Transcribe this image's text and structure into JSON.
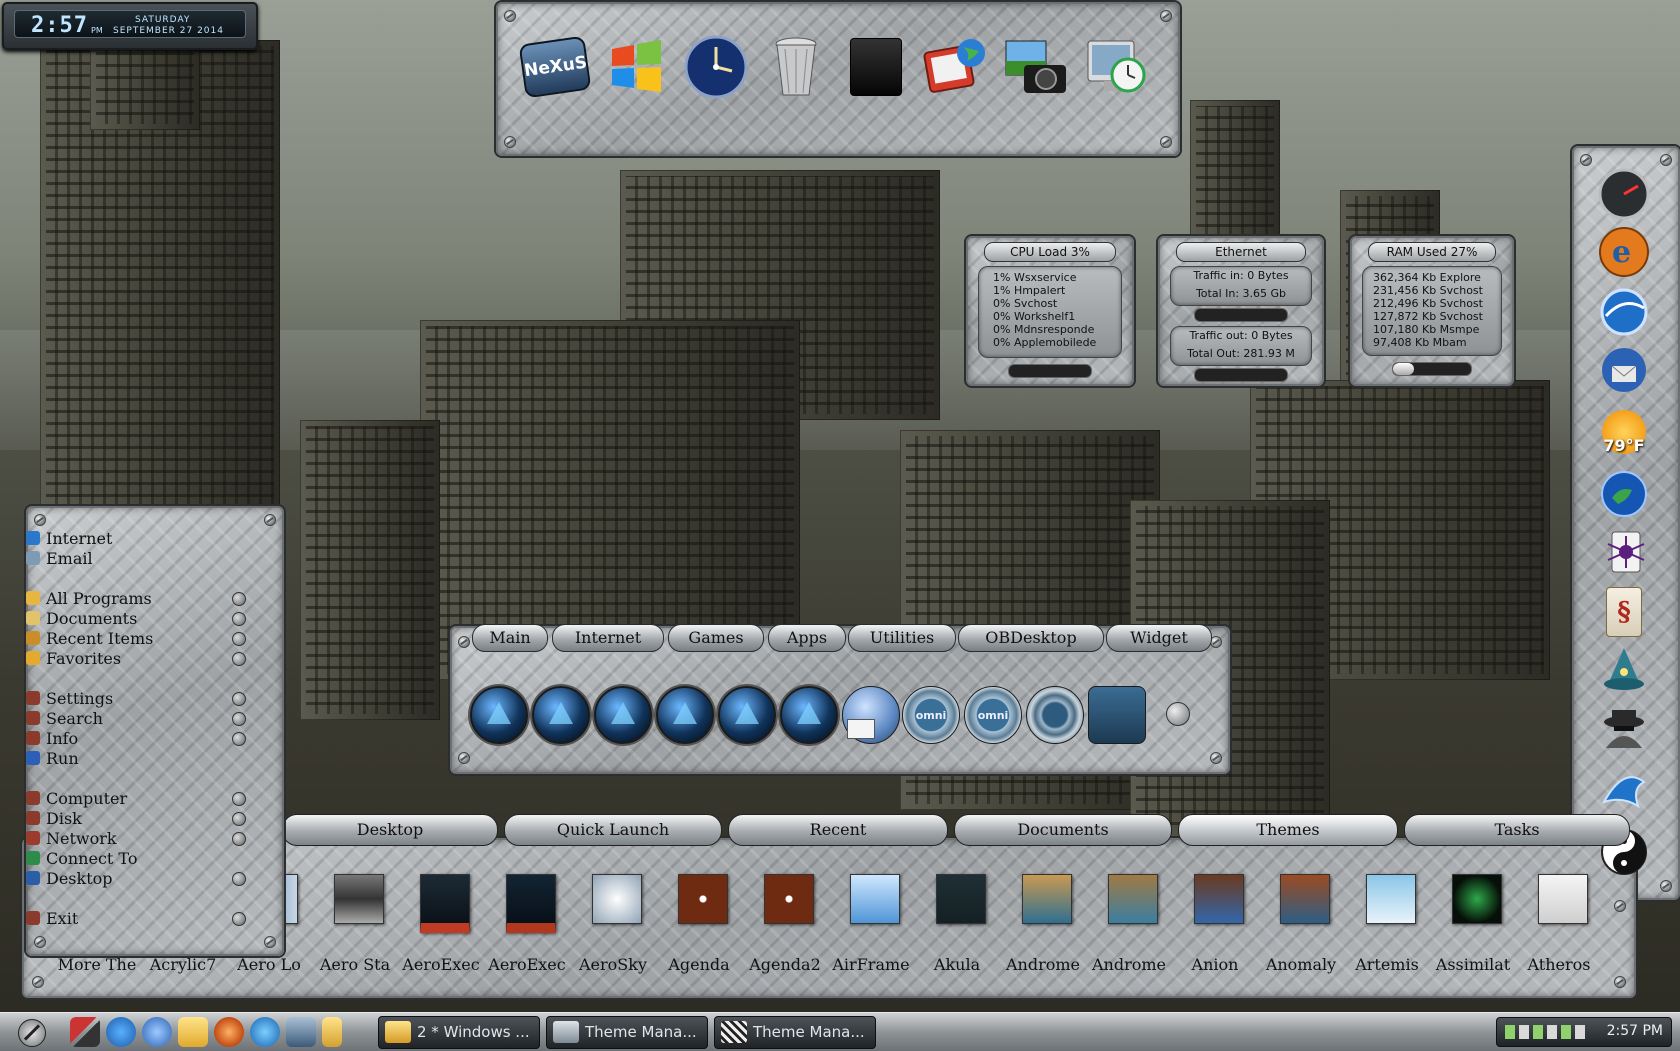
{
  "clock": {
    "time": "2:57",
    "ampm": "PM",
    "day": "SATURDAY",
    "date": "SEPTEMBER 27 2014"
  },
  "top_dock": {
    "icons": [
      "nexus-logo-icon",
      "windows-logo-icon",
      "clock-icon",
      "recycle-bin-icon",
      "black-box-icon",
      "globe-tv-icon",
      "camera-icon",
      "system-clock-icon"
    ],
    "nexus_label": "NeXuS"
  },
  "monitors": {
    "cpu": {
      "title": "CPU Load 3%",
      "processes": [
        "1% Wsxservice",
        "1% Hmpalert",
        "0% Svchost",
        "0% Workshelf1",
        "0% Mdnsresponde",
        "0% Applemobilede"
      ]
    },
    "ethernet": {
      "title": "Ethernet",
      "traffic_in": "Traffic in: 0 Bytes",
      "total_in": "Total In: 3.65 Gb",
      "traffic_out": "Traffic out: 0 Bytes",
      "total_out": "Total Out: 281.93 M"
    },
    "ram": {
      "title": "RAM Used 27%",
      "processes": [
        "362,364 Kb Explore",
        "231,456 Kb Svchost",
        "212,496 Kb Svchost",
        "127,872 Kb Svchost",
        "107,180 Kb Msmpe",
        "97,408 Kb Mbam"
      ],
      "used_fraction": 0.27
    }
  },
  "start_menu": {
    "groups": [
      [
        {
          "label": "Internet",
          "icon": "globe-icon",
          "arrow": false
        },
        {
          "label": "Email",
          "icon": "mail-icon",
          "arrow": false
        }
      ],
      [
        {
          "label": "All Programs",
          "icon": "folder-icon",
          "arrow": true
        },
        {
          "label": "Documents",
          "icon": "document-icon",
          "arrow": true
        },
        {
          "label": "Recent Items",
          "icon": "recent-icon",
          "arrow": true
        },
        {
          "label": "Favorites",
          "icon": "star-icon",
          "arrow": true
        }
      ],
      [
        {
          "label": "Settings",
          "icon": "settings-icon",
          "arrow": true
        },
        {
          "label": "Search",
          "icon": "search-icon",
          "arrow": true
        },
        {
          "label": "Info",
          "icon": "info-icon",
          "arrow": true
        },
        {
          "label": "Run",
          "icon": "run-icon",
          "arrow": false
        }
      ],
      [
        {
          "label": "Computer",
          "icon": "computer-icon",
          "arrow": true
        },
        {
          "label": "Disk",
          "icon": "disk-icon",
          "arrow": true
        },
        {
          "label": "Network",
          "icon": "network-icon",
          "arrow": true
        },
        {
          "label": "Connect To",
          "icon": "connect-icon",
          "arrow": false
        },
        {
          "label": "Desktop",
          "icon": "desktop-icon",
          "arrow": true
        }
      ],
      [
        {
          "label": "Exit",
          "icon": "exit-icon",
          "arrow": true
        }
      ]
    ]
  },
  "tab_dock": {
    "tabs": [
      "Main",
      "Internet",
      "Games",
      "Apps",
      "Utilities",
      "OBDesktop",
      "Widget"
    ],
    "icons": [
      "orb",
      "orb",
      "orb",
      "orb",
      "orb",
      "orb",
      "globe-mail",
      "omni",
      "omni",
      "ring",
      "square"
    ],
    "omni_label": "omni"
  },
  "themes_dock": {
    "tabs": [
      "Desktop",
      "Quick Launch",
      "Recent",
      "Documents",
      "Themes",
      "Tasks"
    ],
    "themes": [
      "More The",
      "Acrylic7",
      "Aero Lo",
      "Aero Sta",
      "AeroExec",
      "AeroExec",
      "AeroSky",
      "Agenda",
      "Agenda2",
      "AirFrame",
      "Akula",
      "Androme",
      "Androme",
      "Anion",
      "Anomaly",
      "Artemis",
      "Assimilat",
      "Atheros"
    ]
  },
  "right_dock": {
    "icons": [
      "speedometer-icon",
      "internet-explorer-icon",
      "blue-sphere-icon",
      "thunderbird-icon",
      "weather-sun-icon",
      "earth-icon",
      "spider-solitaire-icon",
      "mahjong-icon",
      "wizard-icon",
      "spy-icon",
      "sailfish-icon",
      "yin-yang-icon"
    ],
    "temperature": "79°F"
  },
  "taskbar": {
    "tasks": [
      "2 * Windows ...",
      "Theme Mana...",
      "Theme Mana..."
    ],
    "tray_time": "2:57 PM"
  },
  "colors": {
    "accent_blue": "#1e6bb8",
    "plate": "#aeb2b5"
  }
}
